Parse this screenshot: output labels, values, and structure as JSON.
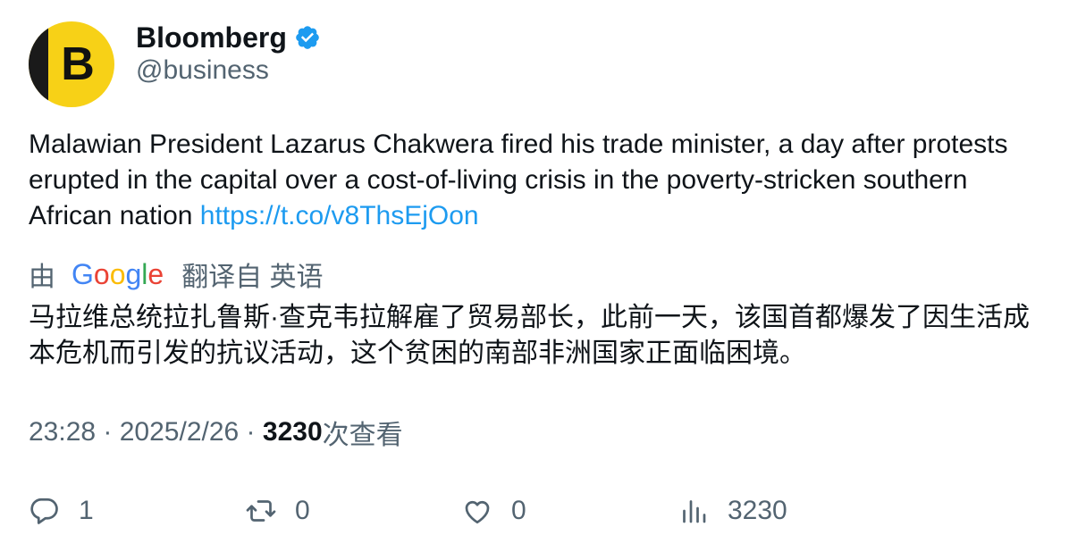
{
  "author": {
    "avatar_letter": "B",
    "name": "Bloomberg",
    "handle": "@business",
    "verified_icon": "verified-badge-icon",
    "verified_color": "#1d9bf0"
  },
  "tweet": {
    "text": "Malawian President Lazarus Chakwera fired his trade minister, a day after protests erupted in the capital over a cost-of-living crisis in the poverty-stricken southern African nation ",
    "link": "https://t.co/v8ThsEjOon",
    "link_color": "#1d9bf0"
  },
  "translation": {
    "prefix": "由",
    "google_letters": [
      "G",
      "o",
      "o",
      "g",
      "l",
      "e"
    ],
    "suffix": "翻译自 英语",
    "text": "马拉维总统拉扎鲁斯·查克韦拉解雇了贸易部长，此前一天，该国首都爆发了因生活成本危机而引发的抗议活动，这个贫困的南部非洲国家正面临困境。"
  },
  "meta": {
    "time": "23:28",
    "separator": " · ",
    "date": "2025/2/26",
    "separator2": " · ",
    "views_count": "3230",
    "views_label": "次查看"
  },
  "actions": {
    "reply": {
      "icon": "reply-icon",
      "count": "1"
    },
    "retweet": {
      "icon": "retweet-icon",
      "count": "0"
    },
    "like": {
      "icon": "heart-icon",
      "count": "0"
    },
    "views": {
      "icon": "analytics-icon",
      "count": "3230"
    }
  },
  "colors": {
    "text_primary": "#0f1419",
    "text_secondary": "#536471",
    "brand_yellow": "#f7d117"
  }
}
